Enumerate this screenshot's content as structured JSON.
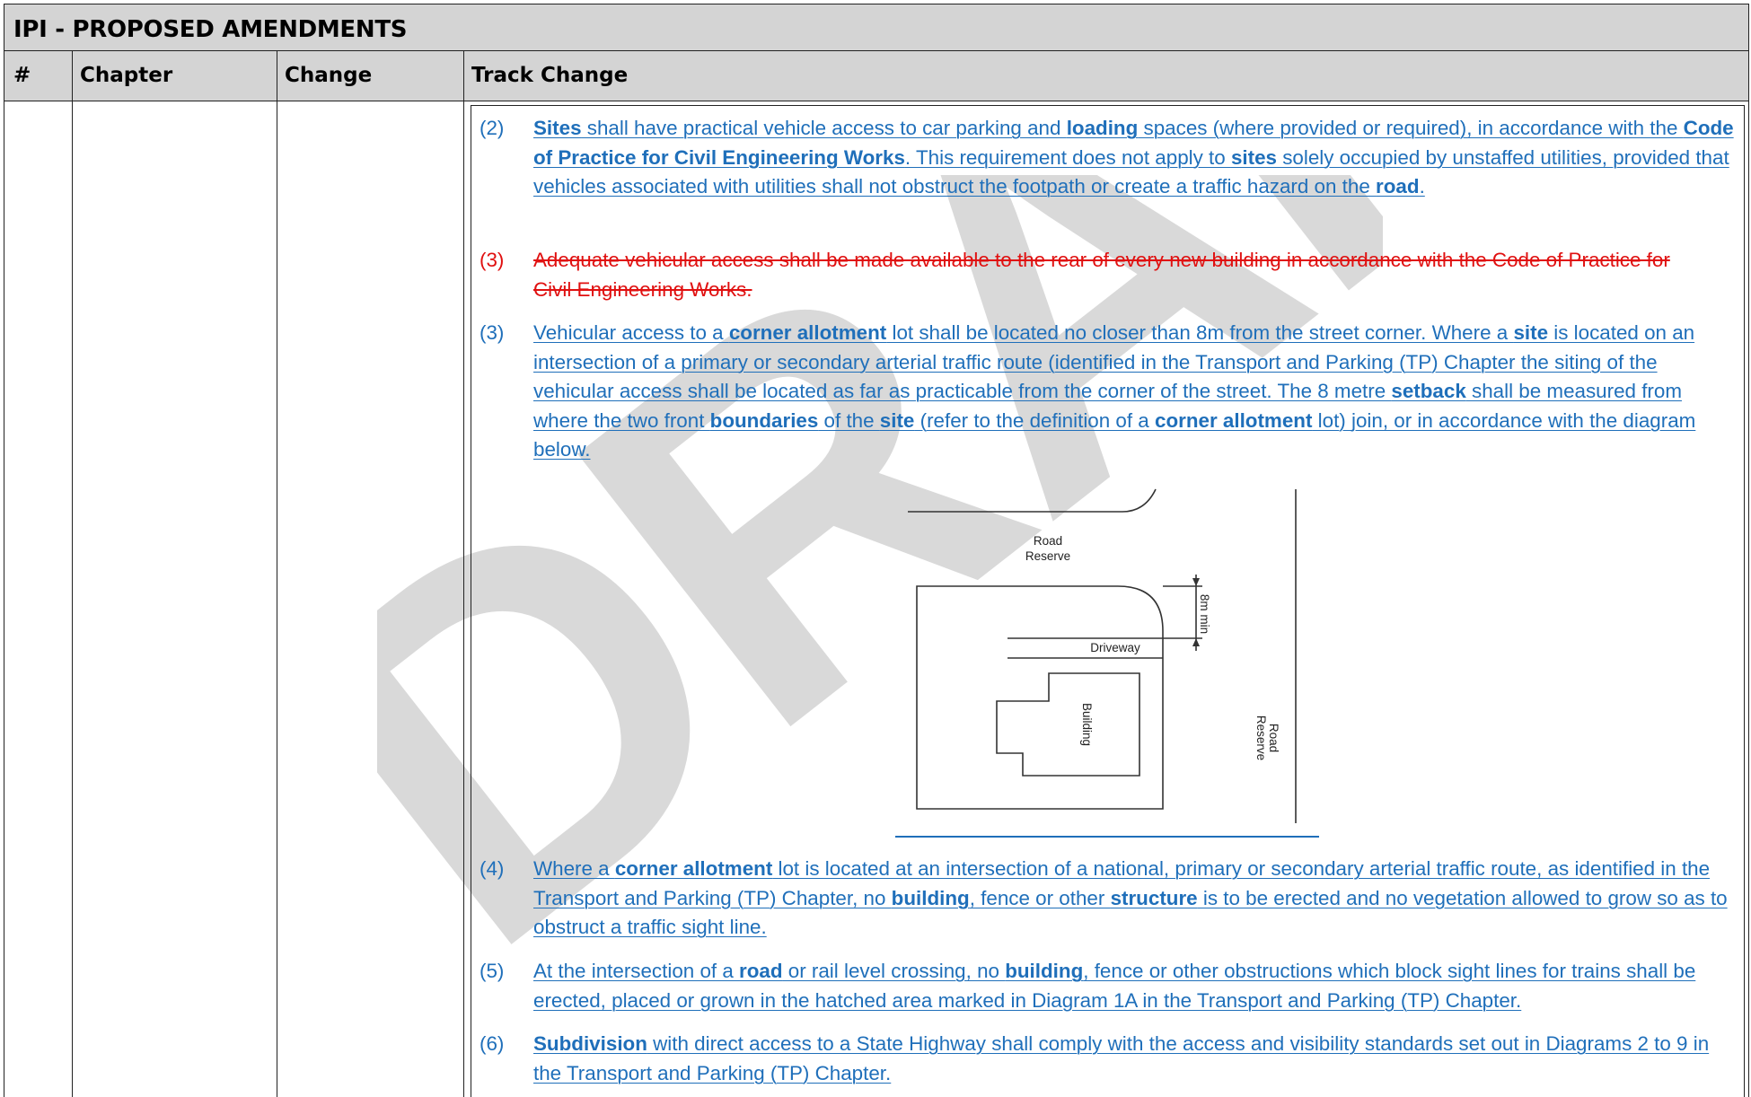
{
  "table": {
    "title": "IPI - PROPOSED AMENDMENTS",
    "columns": [
      "#",
      "Chapter",
      "Change",
      "Track Change"
    ]
  },
  "watermark": "DRAFT",
  "paragraphs": {
    "p2": {
      "num": "(2)",
      "t1": "Sites",
      "t2": " shall have practical vehicle access to car parking and ",
      "t3": "loading",
      "t4": " spaces (where provided or required), in accordance with the ",
      "t5": "Code of Practice for Civil Engineering Works",
      "t6": ". This requirement does not apply to ",
      "t7": "sites",
      "t8": " solely occupied by unstaffed utilities, provided that vehicles associated with utilities shall not obstruct the footpath or create a traffic hazard on the ",
      "t9": "road",
      "t10": "."
    },
    "p3del": {
      "num": "(3)",
      "text": "Adequate vehicular access shall be made available to the rear of every new building in accordance with the Code of Practice for Civil Engineering Works."
    },
    "p3": {
      "num": "(3)",
      "t1": "Vehicular access to a ",
      "t2": "corner allotment",
      "t3": " lot shall be located no closer than 8m from the street corner. Where a ",
      "t4": "site",
      "t5": " is located on an intersection of a primary or secondary arterial traffic route (identified in the Transport and Parking (TP) Chapter the siting of the vehicular access shall be located as far as practicable from the corner of the street. The 8 metre ",
      "t6": "setback",
      "t7": " shall be measured from where the two front ",
      "t8": "boundaries",
      "t9": " of the ",
      "t10": "site",
      "t11": " (refer to the definition of a ",
      "t12": "corner allotment",
      "t13": " lot) join, or in accordance with the diagram below."
    },
    "p4": {
      "num": "(4)",
      "t1": "Where a ",
      "t2": "corner allotment",
      "t3": " lot is located at an intersection of a national, primary or secondary arterial traffic route, as identified in the Transport and Parking (TP) Chapter, no ",
      "t4": "building",
      "t5": ", fence or other ",
      "t6": "structure",
      "t7": " is to be erected and no vegetation allowed to grow so as to obstruct a traffic sight line."
    },
    "p5": {
      "num": "(5)",
      "t1": "At the intersection of a ",
      "t2": "road",
      "t3": " or rail level crossing, no ",
      "t4": "building",
      "t5": ", fence or other obstructions which block sight lines for trains shall be erected, placed or grown in the hatched area marked in Diagram 1A in the Transport and Parking (TP) Chapter."
    },
    "p6": {
      "num": "(6)",
      "t1": "Subdivision",
      "t2": " with direct access to a State Highway shall comply with the access and visibility standards set out in Diagrams 2 to 9 in the Transport and Parking (TP) Chapter."
    }
  },
  "diagram": {
    "road_reserve_top_1": "Road",
    "road_reserve_top_2": "Reserve",
    "driveway": "Driveway",
    "building": "Building",
    "setback": "8m min",
    "road_reserve_side_1": "Road",
    "road_reserve_side_2": "Reserve"
  },
  "colors": {
    "header_bg": "#d4d4d4",
    "insert_text": "#1f6fba",
    "delete_text": "#e01010",
    "watermark": "#d9d9d9"
  }
}
